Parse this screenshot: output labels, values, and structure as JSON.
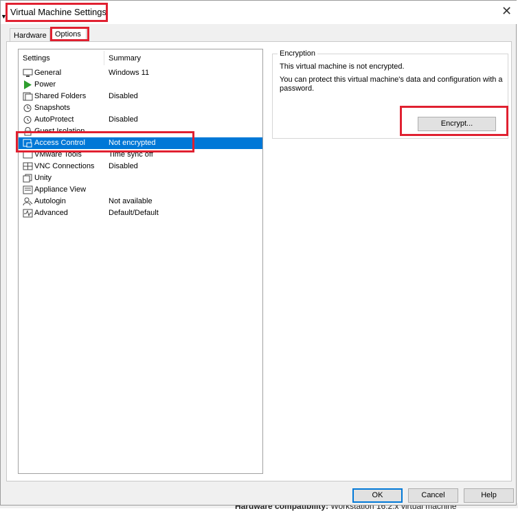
{
  "window": {
    "title": "Virtual Machine Settings",
    "close_glyph": "✕"
  },
  "tabs": [
    {
      "label": "Hardware",
      "active": false
    },
    {
      "label": "Options",
      "active": true
    }
  ],
  "settings_list": {
    "columns": [
      "Settings",
      "Summary"
    ],
    "items": [
      {
        "name": "General",
        "summary": "Windows 11",
        "icon": "monitor-icon"
      },
      {
        "name": "Power",
        "summary": "",
        "icon": "play-icon"
      },
      {
        "name": "Shared Folders",
        "summary": "Disabled",
        "icon": "shared-folder-icon"
      },
      {
        "name": "Snapshots",
        "summary": "",
        "icon": "snapshot-icon"
      },
      {
        "name": "AutoProtect",
        "summary": "Disabled",
        "icon": "autoprotect-icon"
      },
      {
        "name": "Guest Isolation",
        "summary": "",
        "icon": "lock-icon"
      },
      {
        "name": "Access Control",
        "summary": "Not encrypted",
        "icon": "access-control-icon",
        "selected": true
      },
      {
        "name": "VMware Tools",
        "summary": "Time sync off",
        "icon": "vmware-tools-icon"
      },
      {
        "name": "VNC Connections",
        "summary": "Disabled",
        "icon": "vnc-icon"
      },
      {
        "name": "Unity",
        "summary": "",
        "icon": "unity-icon"
      },
      {
        "name": "Appliance View",
        "summary": "",
        "icon": "appliance-icon"
      },
      {
        "name": "Autologin",
        "summary": "Not available",
        "icon": "autologin-icon"
      },
      {
        "name": "Advanced",
        "summary": "Default/Default",
        "icon": "advanced-icon"
      }
    ]
  },
  "encryption": {
    "title": "Encryption",
    "status": "This virtual machine is not encrypted.",
    "description": "You can protect this virtual machine's data and configuration with a password.",
    "encrypt_button": "Encrypt..."
  },
  "buttons": {
    "ok": "OK",
    "cancel": "Cancel",
    "help": "Help"
  },
  "background": {
    "label": "Hardware compatibility:",
    "value": "Workstation 16.2.x virtual machine"
  },
  "colors": {
    "selection": "#0078d7",
    "highlight": "#e02030",
    "play_green": "#2e9e2e"
  }
}
